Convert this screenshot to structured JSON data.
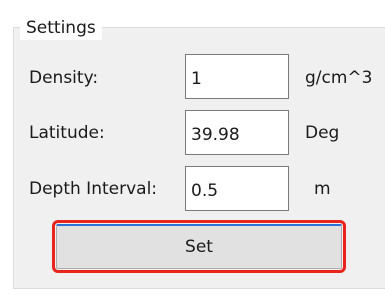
{
  "group": {
    "title": "Settings"
  },
  "fields": {
    "density": {
      "label": "Density:",
      "value": "1",
      "unit": "g/cm^3"
    },
    "latitude": {
      "label": "Latitude:",
      "value": "39.98",
      "unit": "Deg"
    },
    "depth_interval": {
      "label": "Depth Interval:",
      "value": "0.5",
      "unit": "m"
    }
  },
  "actions": {
    "set_label": "Set"
  },
  "colors": {
    "highlight": "#e8241c",
    "focus_accent": "#2b71d3",
    "panel_bg": "#f0f0f0"
  }
}
